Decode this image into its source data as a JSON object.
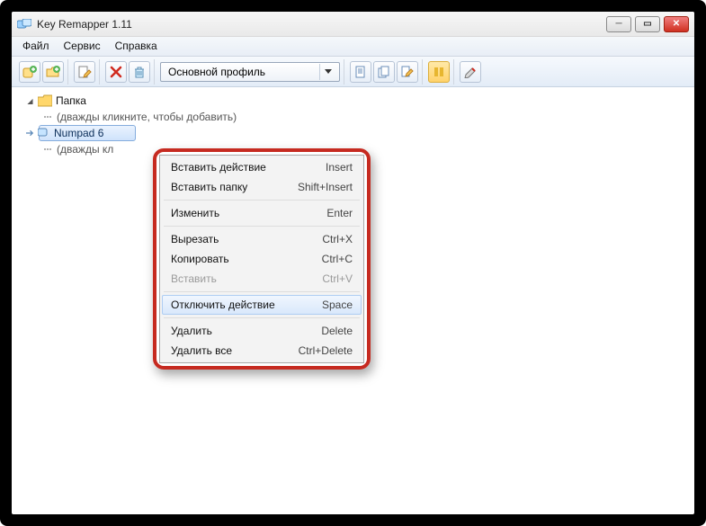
{
  "window": {
    "title": "Key Remapper 1.11"
  },
  "menu": {
    "file": "Файл",
    "service": "Сервис",
    "help": "Справка"
  },
  "toolbar": {
    "profile_selected": "Основной профиль"
  },
  "tree": {
    "folder_label": "Папка",
    "folder_hint": "(дважды кликните, чтобы добавить)",
    "item_label": "Numpad 6",
    "item_hint": "(дважды кл"
  },
  "context_menu": {
    "items": [
      {
        "label": "Вставить действие",
        "shortcut": "Insert",
        "disabled": false,
        "hover": false
      },
      {
        "label": "Вставить папку",
        "shortcut": "Shift+Insert",
        "disabled": false,
        "hover": false
      },
      {
        "sep": true
      },
      {
        "label": "Изменить",
        "shortcut": "Enter",
        "disabled": false,
        "hover": false
      },
      {
        "sep": true
      },
      {
        "label": "Вырезать",
        "shortcut": "Ctrl+X",
        "disabled": false,
        "hover": false
      },
      {
        "label": "Копировать",
        "shortcut": "Ctrl+C",
        "disabled": false,
        "hover": false
      },
      {
        "label": "Вставить",
        "shortcut": "Ctrl+V",
        "disabled": true,
        "hover": false
      },
      {
        "sep": true
      },
      {
        "label": "Отключить действие",
        "shortcut": "Space",
        "disabled": false,
        "hover": true
      },
      {
        "sep": true
      },
      {
        "label": "Удалить",
        "shortcut": "Delete",
        "disabled": false,
        "hover": false
      },
      {
        "label": "Удалить все",
        "shortcut": "Ctrl+Delete",
        "disabled": false,
        "hover": false
      }
    ]
  }
}
